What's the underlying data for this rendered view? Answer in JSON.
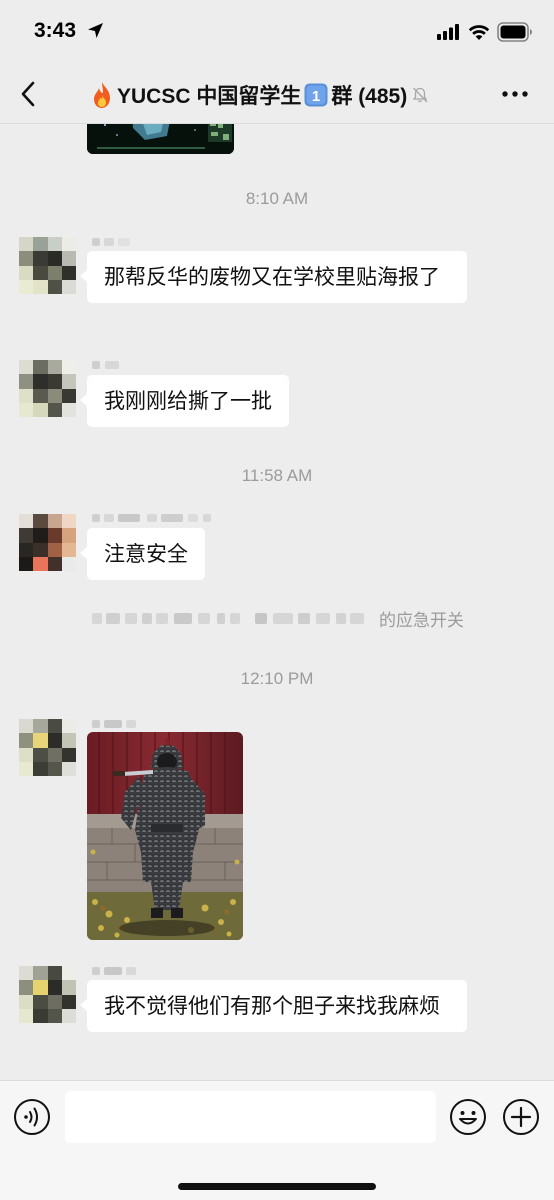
{
  "status_bar": {
    "time": "3:43"
  },
  "nav": {
    "title_prefix": "YUCSC 中国留学生",
    "title_badge": "1",
    "title_suffix": "群 (485)"
  },
  "messages": {
    "ts1": "8:10 AM",
    "m1_text": "那帮反华的废物又在学校里贴海报了",
    "m2_text": "我刚刚给撕了一批",
    "ts2": "11:58 AM",
    "m3_text": "注意安全",
    "system_notice_suffix": "的应急开关",
    "ts3": "12:10 PM",
    "m5_text": "我不觉得他们有那个胆子来找我麻烦"
  },
  "input": {
    "placeholder": ""
  },
  "icons": {
    "back": "chevron-left-icon",
    "more": "more-dots-icon",
    "mute": "bell-mute-icon",
    "voice": "voice-icon",
    "emoji": "emoji-icon",
    "plus": "plus-icon"
  },
  "colors": {
    "background": "#ededed",
    "bubble": "#ffffff",
    "timestamp": "#9b9b9b"
  }
}
